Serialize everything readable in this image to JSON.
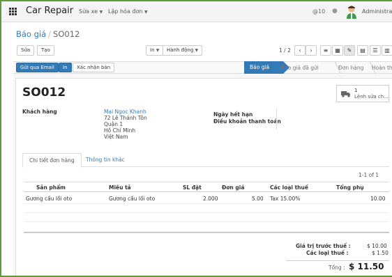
{
  "navbar": {
    "app": "Car Repair",
    "menus": [
      "Sửa xe",
      "Lập hóa đơn"
    ],
    "messages": "@10",
    "user": "Administrator"
  },
  "breadcrumb": {
    "parent": "Báo giá",
    "current": "SO012"
  },
  "controls": {
    "edit": "Sửa",
    "create": "Tạo",
    "print": "In",
    "action": "Hành động",
    "pager": "1 / 2"
  },
  "statusbar": {
    "buttons": [
      "Gửi qua Email",
      "In",
      "Xác nhận bán"
    ],
    "stages": [
      "Báo giá",
      "Báo giá đã gửi",
      "Đơn hàng",
      "Hoàn thành"
    ],
    "active_stage": "Báo giá"
  },
  "record": {
    "name": "SO012",
    "smart_button": {
      "count": "1",
      "label": "Lệnh sửa ch..."
    },
    "customer_label": "Khách hàng",
    "customer": {
      "name": "Mai Ngoc Khanh",
      "street": "72 Lê Thánh Tôn",
      "district": "Quận 1",
      "city": "Hồ Chí Minh",
      "country": "Việt Nam"
    },
    "expiry_label": "Ngày hết hạn",
    "payment_terms_label": "Điều khoản thanh toán"
  },
  "tabs": [
    "Chi tiết đơn hàng",
    "Thông tin khác"
  ],
  "lines": {
    "range": "1-1 of 1",
    "headers": [
      "Sản phẩm",
      "Miêu tả",
      "SL đặt",
      "Đơn giá",
      "Các loại thuế",
      "Tổng phụ"
    ],
    "rows": [
      {
        "product": "Gương cầu lồi oto",
        "description": "Gương cầu lồi oto",
        "qty": "2.000",
        "price": "5.00",
        "taxes": "Tax 15.00%",
        "subtotal": "10.00"
      }
    ]
  },
  "totals": {
    "untaxed_label": "Giá trị trước thuế :",
    "untaxed": "$ 10.00",
    "taxes_label": "Các loại thuế :",
    "taxes": "$ 1.50",
    "total_label": "Tổng :",
    "total": "$ 11.50"
  },
  "colors": {
    "primary": "#337ab7",
    "frame": "#5d9a3a"
  }
}
